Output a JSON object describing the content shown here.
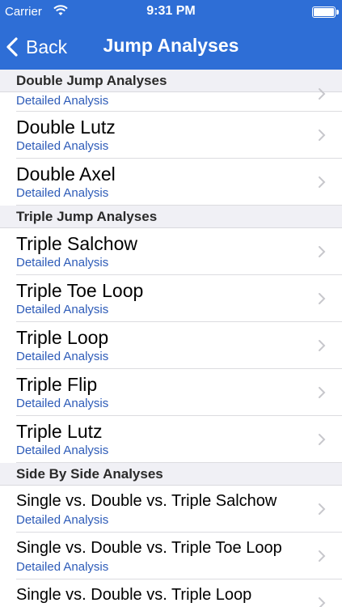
{
  "status": {
    "carrier": "Carrier",
    "time": "9:31 PM"
  },
  "nav": {
    "back_label": "Back",
    "title": "Jump Analyses"
  },
  "sections": {
    "double": {
      "header": "Double Jump Analyses",
      "partial_subtitle": "Detailed Analysis",
      "items": [
        {
          "title": "Double Lutz",
          "subtitle": "Detailed Analysis"
        },
        {
          "title": "Double Axel",
          "subtitle": "Detailed Analysis"
        }
      ]
    },
    "triple": {
      "header": "Triple Jump Analyses",
      "items": [
        {
          "title": "Triple Salchow",
          "subtitle": "Detailed Analysis"
        },
        {
          "title": "Triple Toe Loop",
          "subtitle": "Detailed Analysis"
        },
        {
          "title": "Triple Loop",
          "subtitle": "Detailed Analysis"
        },
        {
          "title": "Triple Flip",
          "subtitle": "Detailed Analysis"
        },
        {
          "title": "Triple Lutz",
          "subtitle": "Detailed Analysis"
        }
      ]
    },
    "side": {
      "header": "Side By Side Analyses",
      "items": [
        {
          "title": "Single vs. Double vs. Triple Salchow",
          "subtitle": "Detailed Analysis"
        },
        {
          "title": "Single vs. Double vs. Triple Toe Loop",
          "subtitle": "Detailed Analysis"
        },
        {
          "title": "Single vs. Double vs. Triple Loop"
        }
      ]
    }
  }
}
